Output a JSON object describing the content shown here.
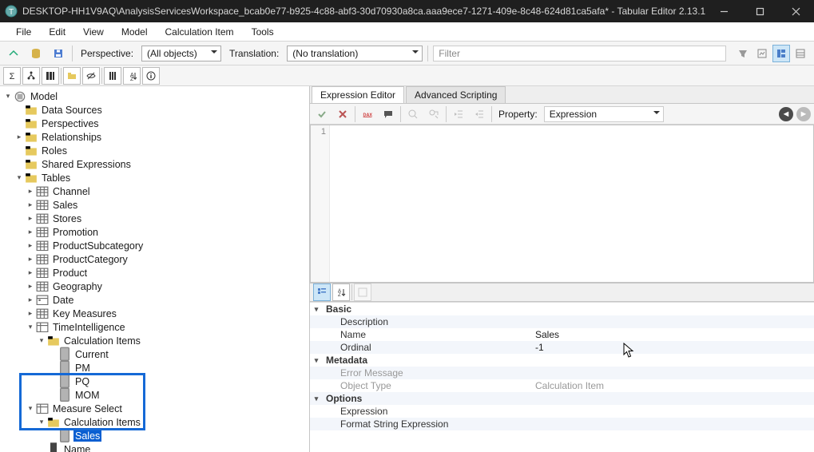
{
  "window": {
    "title": "DESKTOP-HH1V9AQ\\AnalysisServicesWorkspace_bcab0e77-b925-4c88-abf3-30d70930a8ca.aaa9ece7-1271-409e-8c48-624d81ca5afa* - Tabular Editor 2.13.1"
  },
  "menu": {
    "file": "File",
    "edit": "Edit",
    "view": "View",
    "model": "Model",
    "calcitem": "Calculation Item",
    "tools": "Tools"
  },
  "toolbar": {
    "perspective_label": "Perspective:",
    "perspective_value": "(All objects)",
    "translation_label": "Translation:",
    "translation_value": "(No translation)",
    "filter_placeholder": "Filter"
  },
  "tree": {
    "model": "Model",
    "datasources": "Data Sources",
    "perspectives": "Perspectives",
    "relationships": "Relationships",
    "roles": "Roles",
    "sharedexpr": "Shared Expressions",
    "tables": "Tables",
    "channel": "Channel",
    "sales": "Sales",
    "stores": "Stores",
    "promotion": "Promotion",
    "prodsub": "ProductSubcategory",
    "prodcat": "ProductCategory",
    "product": "Product",
    "geography": "Geography",
    "date": "Date",
    "keymeasures": "Key Measures",
    "timeint": "TimeIntelligence",
    "calcitems": "Calculation Items",
    "current": "Current",
    "pm": "PM",
    "pq": "PQ",
    "mom": "MOM",
    "measureselect": "Measure Select",
    "calcitems2": "Calculation Items",
    "sales_item": "Sales",
    "name_col": "Name"
  },
  "tabs": {
    "expr": "Expression Editor",
    "adv": "Advanced Scripting"
  },
  "exprbar": {
    "property_label": "Property:",
    "property_value": "Expression"
  },
  "editor": {
    "line1": "1"
  },
  "props": {
    "basic": "Basic",
    "desc": "Description",
    "name": "Name",
    "name_val": "Sales",
    "ordinal": "Ordinal",
    "ordinal_val": "-1",
    "metadata": "Metadata",
    "errmsg": "Error Message",
    "objtype": "Object Type",
    "objtype_val": "Calculation Item",
    "options": "Options",
    "expression": "Expression",
    "formatstr": "Format String Expression"
  }
}
